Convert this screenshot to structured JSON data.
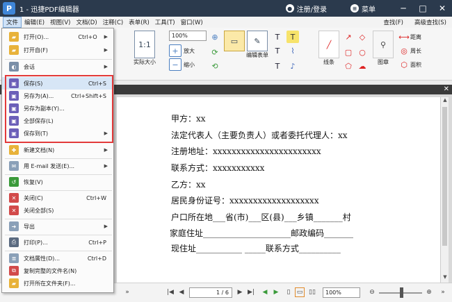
{
  "titlebar": {
    "title": "1 - 迅捷PDF编辑器",
    "login": "注册/登录",
    "menu": "菜单",
    "minimize": "─",
    "maximize": "□",
    "close": "✕"
  },
  "menubar": {
    "items": [
      "文件",
      "编辑(E)",
      "视图(V)",
      "文档(D)",
      "注释(C)",
      "表单(R)",
      "工具(T)",
      "窗口(W)"
    ],
    "find": "查找(F)",
    "advanced_find": "高级查找(S)"
  },
  "toolbar": {
    "actual_size": "实际大小",
    "zoom": "100%",
    "zoom_in": "放大",
    "zoom_out": "缩小",
    "edit_form": "编辑表单",
    "line": "线条",
    "stamp": "图章",
    "distance": "距离",
    "perimeter": "周长",
    "area": "面积"
  },
  "file_menu": {
    "items": [
      {
        "label": "打开(O)...",
        "shortcut": "Ctrl+O",
        "arrow": true
      },
      {
        "label": "打开自(F)",
        "shortcut": "",
        "arrow": true
      },
      {
        "label": "会话",
        "shortcut": "",
        "arrow": true
      },
      {
        "label": "保存(S)",
        "shortcut": "Ctrl+S",
        "arrow": false
      },
      {
        "label": "另存为(A)...",
        "shortcut": "Ctrl+Shift+S",
        "arrow": false
      },
      {
        "label": "另存为副本(Y)...",
        "shortcut": "",
        "arrow": false
      },
      {
        "label": "全部保存(L)",
        "shortcut": "",
        "arrow": false
      },
      {
        "label": "保存到(T)",
        "shortcut": "",
        "arrow": true
      },
      {
        "label": "新建文档(N)",
        "shortcut": "",
        "arrow": true
      },
      {
        "label": "用 E-mail 发送(E)...",
        "shortcut": "",
        "arrow": true
      },
      {
        "label": "恢复(V)",
        "shortcut": "",
        "arrow": false
      },
      {
        "label": "关闭(C)",
        "shortcut": "Ctrl+W",
        "arrow": false
      },
      {
        "label": "关闭全部(S)",
        "shortcut": "",
        "arrow": false
      },
      {
        "label": "导出",
        "shortcut": "",
        "arrow": true
      },
      {
        "label": "打印(P)...",
        "shortcut": "Ctrl+P",
        "arrow": false
      },
      {
        "label": "文档属性(D)...",
        "shortcut": "Ctrl+D",
        "arrow": false
      },
      {
        "label": "复制完整的文件名(N)",
        "shortcut": "",
        "arrow": false
      },
      {
        "label": "打开所在文件夹(F)...",
        "shortcut": "",
        "arrow": false
      }
    ]
  },
  "document": {
    "lines": [
      "甲方：xx",
      "法定代表人（主要负责人）或者委托代理人：xx",
      "注册地址：xxxxxxxxxxxxxxxxxxxxxxx",
      "联系方式：xxxxxxxxxxx",
      "乙方：xx",
      "居民身份证号：xxxxxxxxxxxxxxxxxxx",
      "户口所在地___省(市)___区(县)___乡镇_______村",
      "家庭住址_____________________邮政编码_______",
      "现住址___________ _____联系方式__________"
    ]
  },
  "statusbar": {
    "page": "1 / 6",
    "zoom": "100%"
  }
}
